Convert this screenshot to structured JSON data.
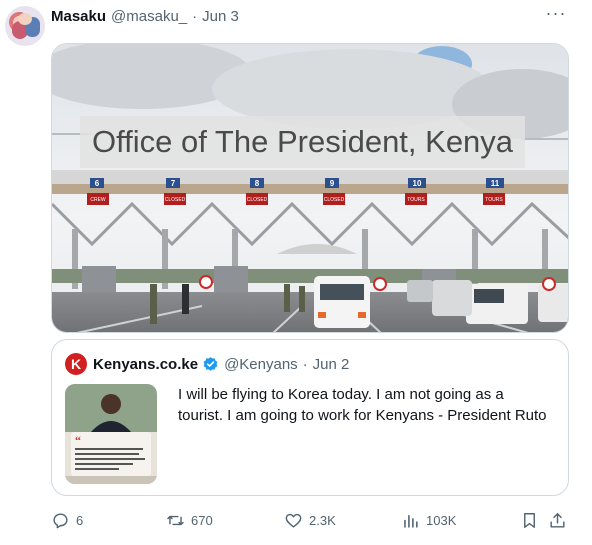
{
  "tweet": {
    "author_name": "Masaku",
    "author_handle": "@masaku_",
    "separator": "·",
    "date": "Jun 3",
    "more_label": "···",
    "media": {
      "overlay_title": "Office of The President, Kenya",
      "lane_numbers": [
        "6",
        "7",
        "8",
        "9",
        "10",
        "11"
      ],
      "lane_signs": [
        "CREW",
        "CLOSED",
        "CLOSED",
        "CLOSED",
        "TOURS",
        "TOURS"
      ]
    },
    "quote": {
      "logo_letter": "K",
      "author_name": "Kenyans.co.ke",
      "author_handle": "@Kenyans",
      "separator": "·",
      "date": "Jun 2",
      "text_lines": [
        "I will be flying to Korea today. I am not going as a",
        "tourist. I am going to work for Kenyans - President Ruto"
      ],
      "thumbnail_quote": "I will be flying to Korea today. I am not going as a tourist. I am going to work for Kenyans."
    },
    "actions": {
      "replies": "6",
      "retweets": "670",
      "likes": "2.3K",
      "views": "103K"
    },
    "icons": {
      "reply": "reply-icon",
      "retweet": "retweet-icon",
      "like": "heart-icon",
      "views": "views-icon",
      "bookmark": "bookmark-icon",
      "share": "share-icon"
    },
    "colors": {
      "text_secondary": "#536471",
      "verified": "#1d9bf0",
      "kenyans_red": "#d21f1f"
    }
  }
}
